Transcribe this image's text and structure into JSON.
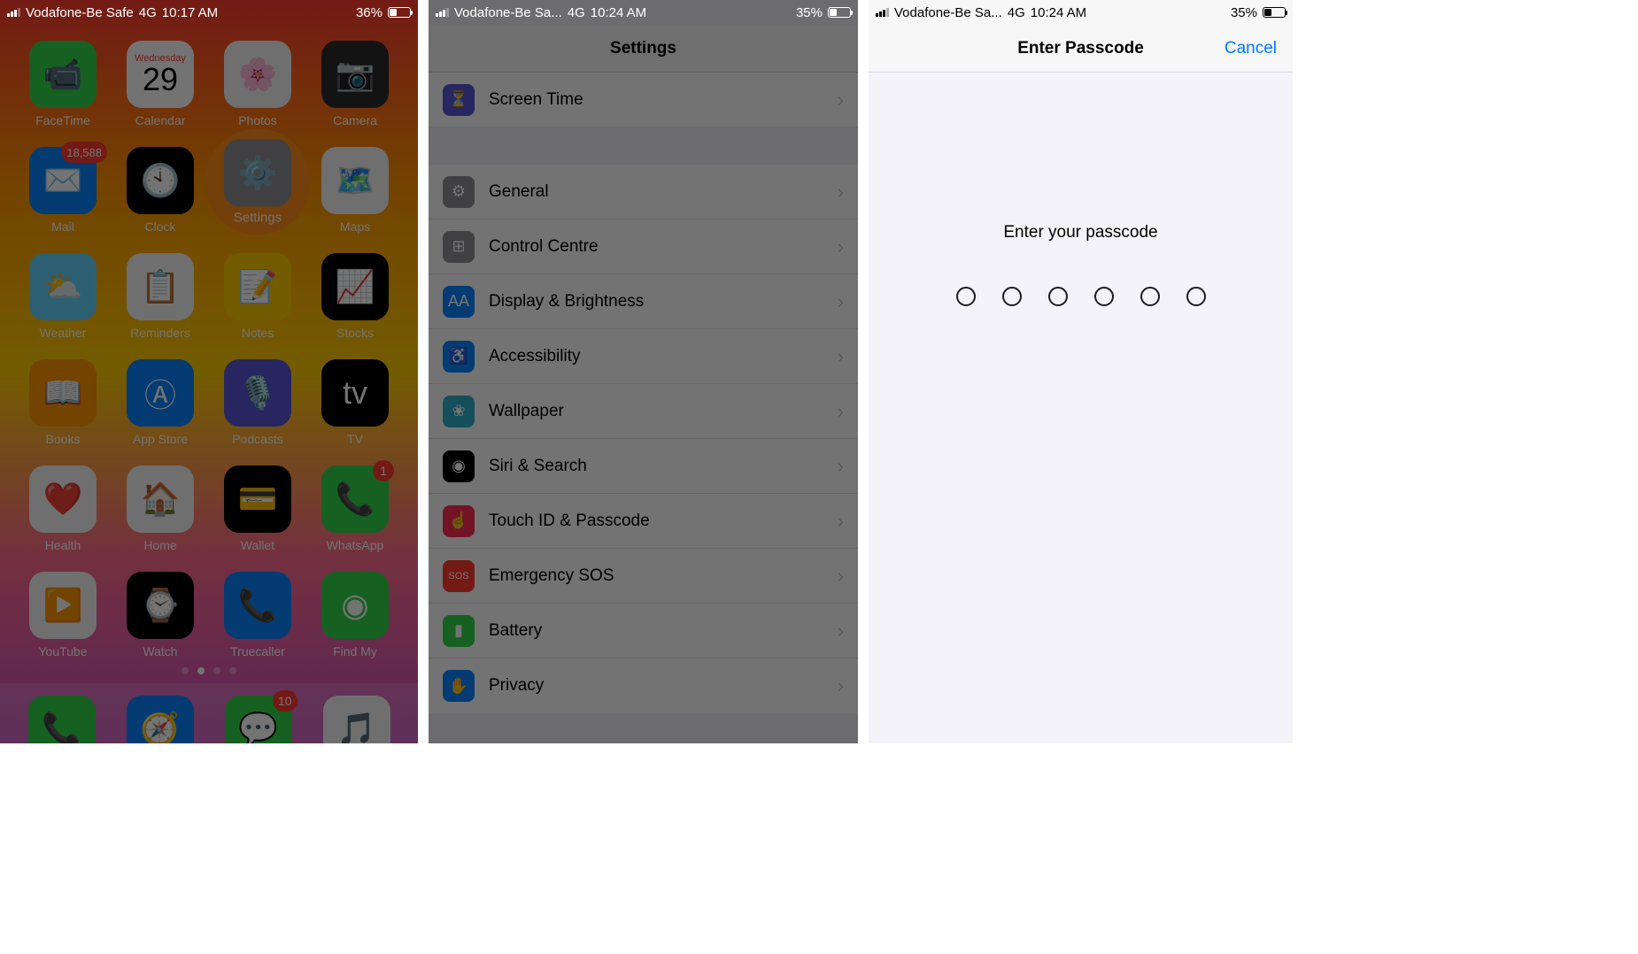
{
  "screen1": {
    "status": {
      "carrier": "Vodafone-Be Safe",
      "network": "4G",
      "time": "10:17 AM",
      "battery": "36%"
    },
    "apps": [
      {
        "name": "FaceTime",
        "color": "bg-green",
        "glyph": "📹"
      },
      {
        "name": "Calendar",
        "color": "calendar-box",
        "day": "Wednesday",
        "date": "29"
      },
      {
        "name": "Photos",
        "color": "bg-white",
        "glyph": "🌸"
      },
      {
        "name": "Camera",
        "color": "bg-darkgray",
        "glyph": "📷"
      },
      {
        "name": "Mail",
        "color": "bg-blue",
        "glyph": "✉️",
        "badge": "18,588"
      },
      {
        "name": "Clock",
        "color": "bg-black",
        "glyph": "🕙"
      },
      {
        "name": "Settings",
        "color": "bg-gray",
        "glyph": "⚙️",
        "highlighted": true
      },
      {
        "name": "Maps",
        "color": "bg-white",
        "glyph": "🗺️"
      },
      {
        "name": "Weather",
        "color": "bg-lightblue",
        "glyph": "⛅"
      },
      {
        "name": "Reminders",
        "color": "bg-white",
        "glyph": "📋"
      },
      {
        "name": "Notes",
        "color": "bg-yellow",
        "glyph": "📝"
      },
      {
        "name": "Stocks",
        "color": "bg-black",
        "glyph": "📈"
      },
      {
        "name": "Books",
        "color": "bg-orange",
        "glyph": "📖"
      },
      {
        "name": "App Store",
        "color": "bg-blue",
        "glyph": "Ⓐ"
      },
      {
        "name": "Podcasts",
        "color": "bg-purple",
        "glyph": "🎙️"
      },
      {
        "name": "TV",
        "color": "bg-black",
        "glyph": "tv"
      },
      {
        "name": "Health",
        "color": "bg-white",
        "glyph": "❤️"
      },
      {
        "name": "Home",
        "color": "bg-white",
        "glyph": "🏠"
      },
      {
        "name": "Wallet",
        "color": "bg-black",
        "glyph": "💳"
      },
      {
        "name": "WhatsApp",
        "color": "bg-green",
        "glyph": "📞",
        "badge": "1"
      },
      {
        "name": "YouTube",
        "color": "bg-white",
        "glyph": "▶️"
      },
      {
        "name": "Watch",
        "color": "bg-black",
        "glyph": "⌚"
      },
      {
        "name": "Truecaller",
        "color": "bg-blue",
        "glyph": "📞"
      },
      {
        "name": "Find My",
        "color": "bg-green",
        "glyph": "◉"
      }
    ],
    "dock": [
      {
        "name": "Phone",
        "color": "bg-green",
        "glyph": "📞"
      },
      {
        "name": "Safari",
        "color": "bg-blue",
        "glyph": "🧭"
      },
      {
        "name": "Messages",
        "color": "bg-green",
        "glyph": "💬",
        "badge": "10"
      },
      {
        "name": "Music",
        "color": "bg-white",
        "glyph": "🎵"
      }
    ]
  },
  "screen2": {
    "status": {
      "carrier": "Vodafone-Be Sa...",
      "network": "4G",
      "time": "10:24 AM",
      "battery": "35%"
    },
    "title": "Settings",
    "rows": [
      {
        "label": "Screen Time",
        "icon": "⏳",
        "color": "bg-purple"
      },
      {
        "label": "General",
        "icon": "⚙",
        "color": "bg-gray",
        "gap": true
      },
      {
        "label": "Control Centre",
        "icon": "⊞",
        "color": "bg-gray"
      },
      {
        "label": "Display & Brightness",
        "icon": "AA",
        "color": "bg-blue"
      },
      {
        "label": "Accessibility",
        "icon": "♿",
        "color": "bg-blue"
      },
      {
        "label": "Wallpaper",
        "icon": "❀",
        "color": "bg-teal"
      },
      {
        "label": "Siri & Search",
        "icon": "◉",
        "color": "bg-black"
      },
      {
        "label": "Touch ID & Passcode",
        "icon": "☝",
        "color": "bg-pink",
        "highlighted": true
      },
      {
        "label": "Emergency SOS",
        "icon": "SOS",
        "color": "bg-red"
      },
      {
        "label": "Battery",
        "icon": "▮",
        "color": "bg-green"
      },
      {
        "label": "Privacy",
        "icon": "✋",
        "color": "bg-blue"
      }
    ]
  },
  "screen3": {
    "status": {
      "carrier": "Vodafone-Be Sa...",
      "network": "4G",
      "time": "10:24 AM",
      "battery": "35%"
    },
    "title": "Enter Passcode",
    "cancel": "Cancel",
    "prompt": "Enter your passcode",
    "digits": 6
  }
}
